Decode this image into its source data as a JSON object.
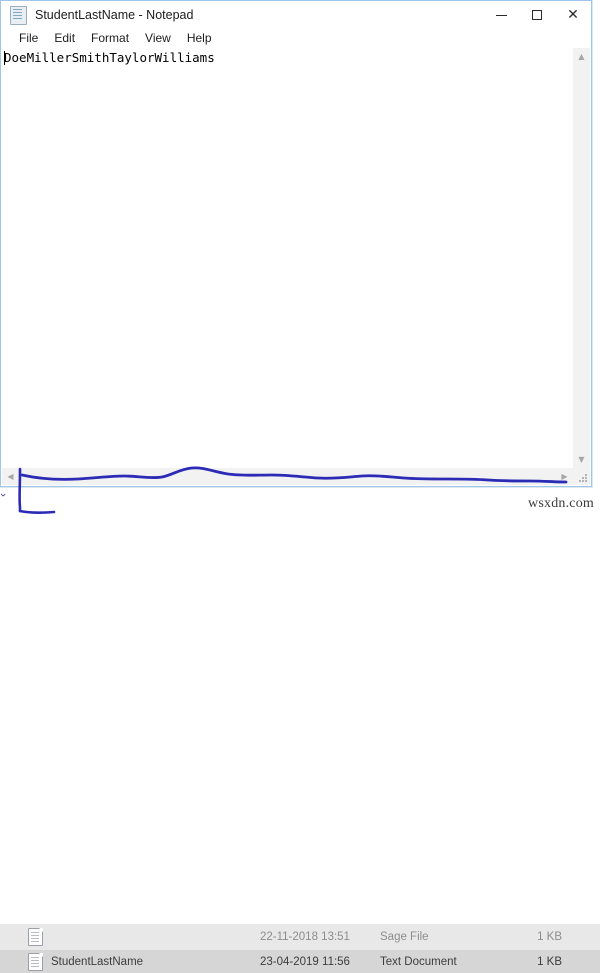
{
  "window": {
    "title": "StudentLastName - Notepad",
    "icon": "notepad-document-icon",
    "controls": {
      "minimize": "—",
      "maximize": "☐",
      "close": "✕"
    }
  },
  "menubar": {
    "items": [
      {
        "label": "File"
      },
      {
        "label": "Edit"
      },
      {
        "label": "Format"
      },
      {
        "label": "View"
      },
      {
        "label": "Help"
      }
    ]
  },
  "editor": {
    "content": "DoeMillerSmithTaylorWilliams",
    "caret_at_start": true
  },
  "scrollbars": {
    "up_arrow": "▲",
    "down_arrow": "▼",
    "left_arrow": "◀",
    "right_arrow": "▶"
  },
  "explorer": {
    "rows": [
      {
        "name": "",
        "date": "22-11-2018 13:51",
        "type": "Sage File",
        "size": "1 KB",
        "obscured": true
      },
      {
        "name": "StudentLastName",
        "date": "23-04-2019 11:56",
        "type": "Text Document",
        "size": "1 KB",
        "obscured": false
      }
    ],
    "left_chevron": "›"
  },
  "watermark": {
    "text": "wsxdn.com"
  },
  "colors": {
    "window_border": "#9fc5e8",
    "annotation": "#2b2bb5",
    "selected_row": "#d6d6d6",
    "top_row": "#e8e8e8"
  }
}
